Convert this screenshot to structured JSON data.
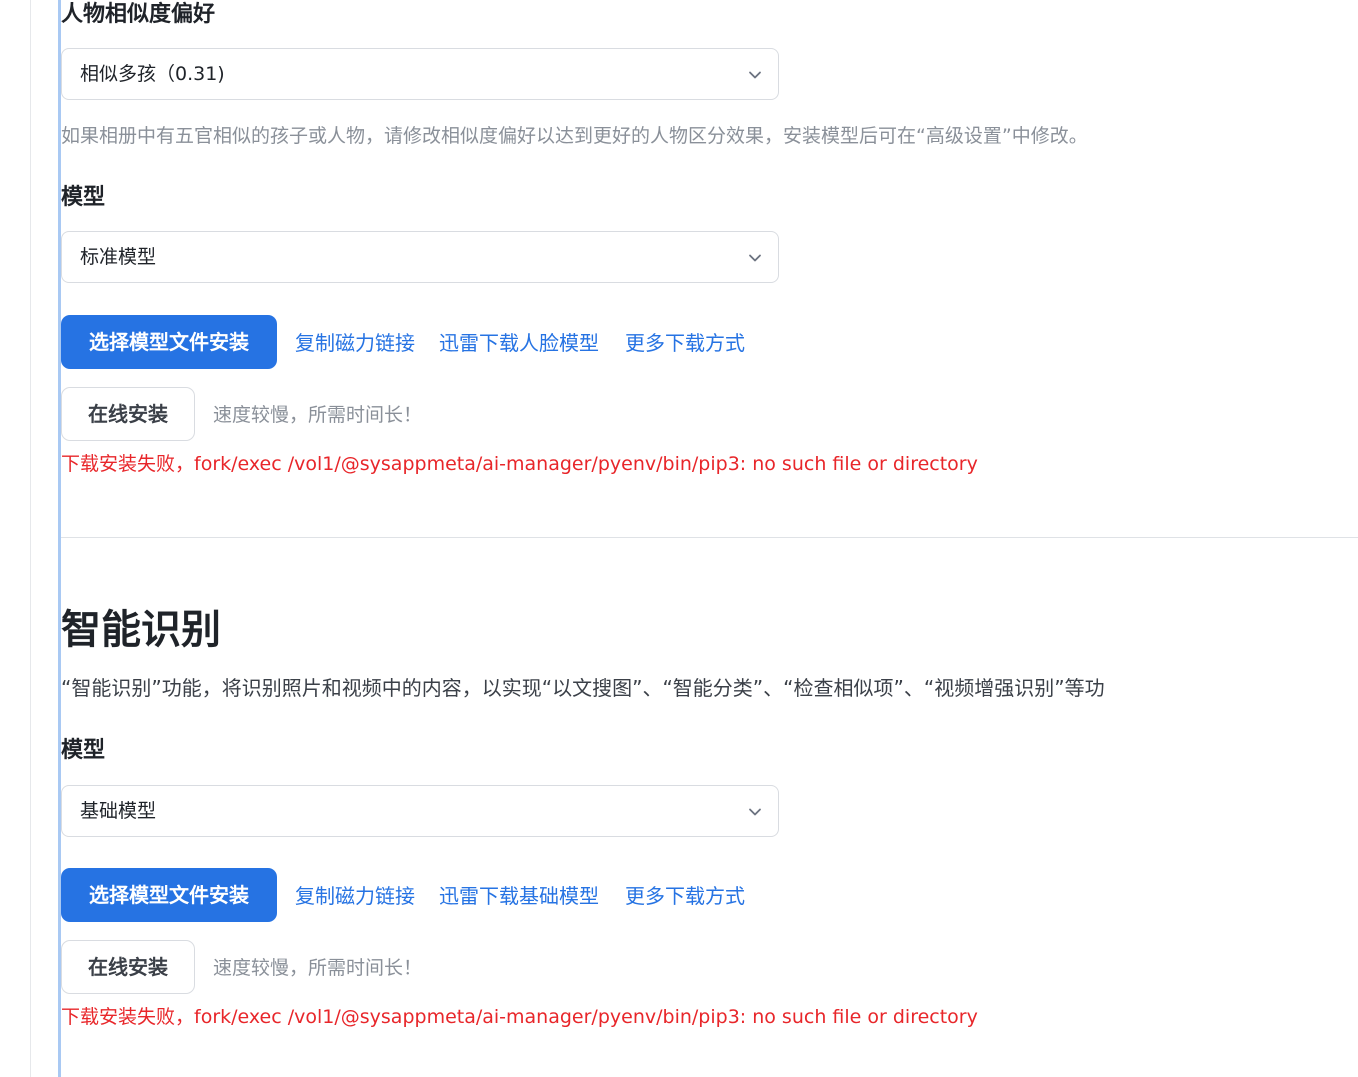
{
  "people": {
    "similarity_label": "人物相似度偏好",
    "similarity_value": "相似多孩（0.31)",
    "similarity_hint": "如果相册中有五官相似的孩子或人物，请修改相似度偏好以达到更好的人物区分效果，安装模型后可在“高级设置”中修改。",
    "model_label": "模型",
    "model_value": "标准模型",
    "install_button": "选择模型文件安装",
    "link_magnet": "复制磁力链接",
    "link_thunder": "迅雷下载人脸模型",
    "link_more": "更多下载方式",
    "online_button": "在线安装",
    "online_note": "速度较慢，所需时间长！",
    "error": "下载安装失败，fork/exec /vol1/@sysappmeta/ai-manager/pyenv/bin/pip3: no such file or directory"
  },
  "smart": {
    "title": "智能识别",
    "description": "“智能识别”功能，将识别照片和视频中的内容，以实现“以文搜图”、“智能分类”、“检查相似项”、“视频增强识别”等功",
    "model_label": "模型",
    "model_value": "基础模型",
    "install_button": "选择模型文件安装",
    "link_magnet": "复制磁力链接",
    "link_thunder": "迅雷下载基础模型",
    "link_more": "更多下载方式",
    "online_button": "在线安装",
    "online_note": "速度较慢，所需时间长！",
    "error": "下载安装失败，fork/exec /vol1/@sysappmeta/ai-manager/pyenv/bin/pip3: no such file or directory"
  },
  "icons": {
    "select_arrow": "chevron-down-icon"
  },
  "colors": {
    "primary": "#2673e3",
    "error": "#e8262a",
    "hint": "#8a9099",
    "accent_line": "#a9c9f3"
  }
}
